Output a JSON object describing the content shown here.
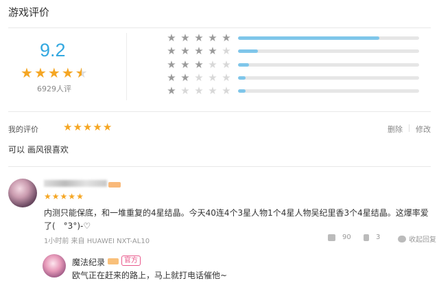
{
  "header": {
    "title": "游戏评价"
  },
  "summary": {
    "score": "9.2",
    "stars": 4.5,
    "count_label": "6929人评"
  },
  "distribution": [
    {
      "stars": 5,
      "fraction": 0.78
    },
    {
      "stars": 4,
      "fraction": 0.11
    },
    {
      "stars": 3,
      "fraction": 0.06
    },
    {
      "stars": 2,
      "fraction": 0.04
    },
    {
      "stars": 1,
      "fraction": 0.04
    }
  ],
  "my_review": {
    "label": "我的评价",
    "stars": 5,
    "delete_label": "删除",
    "edit_label": "修改",
    "text": "可以 画风很喜欢"
  },
  "comment": {
    "stars": 5,
    "text": "内测只能保底，和一堆重复的4星结晶。今天40连4个3星人物1个4星人物吴纪里香3个4星结晶。这爆率爱了(　°3°)-♡",
    "meta": "1小时前 来自 HUAWEI NXT-AL10",
    "likes": "90",
    "replies": "3",
    "collapse_label": "收起回复"
  },
  "reply": {
    "name": "魔法纪录",
    "badge": "官方",
    "text": "欧气正在赶来的路上，马上就打电话催他~"
  },
  "colors": {
    "accent": "#33a8e0",
    "star": "#f5a623",
    "bar": "#7fc6ea",
    "official": "#e8578a"
  }
}
